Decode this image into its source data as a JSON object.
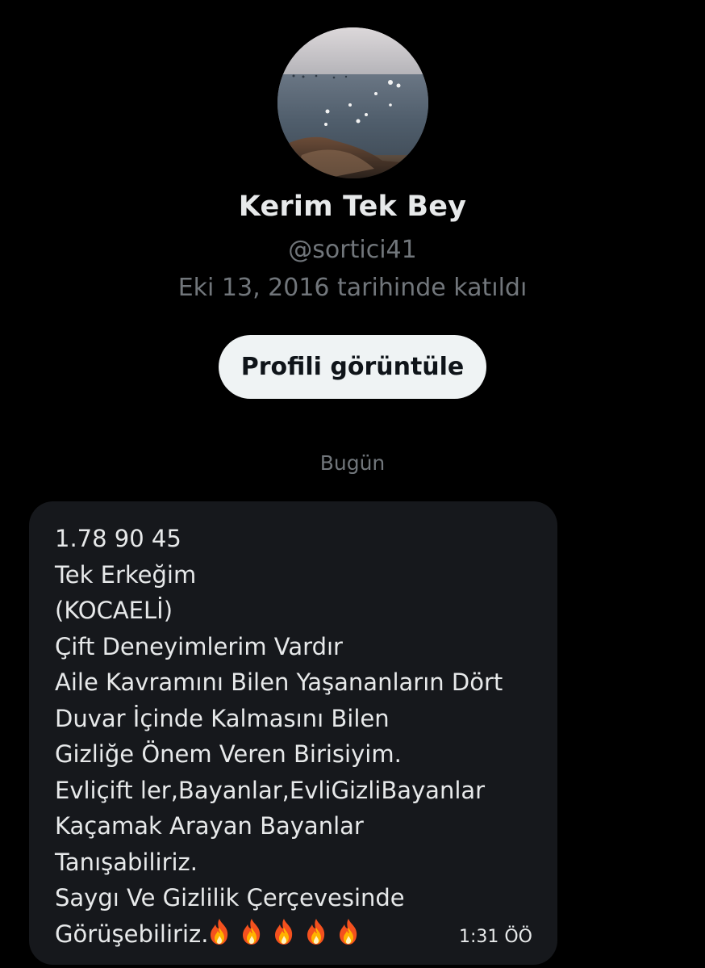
{
  "profile": {
    "display_name": "Kerim Tek Bey",
    "handle": "@sortici41",
    "joined": "Eki 13, 2016 tarihinde katıldı",
    "view_profile_label": "Profili görüntüle"
  },
  "conversation": {
    "day_separator": "Bugün",
    "message": {
      "lines": [
        "1.78 90 45",
        "Tek Erkeğim",
        "(KOCAELİ)",
        "Çift Deneyimlerim Vardır",
        "Aile Kavramını Bilen Yaşananların Dört",
        "Duvar İçinde Kalmasını Bilen",
        "Gizliğe Önem Veren Birisiyim.",
        "Evliçift ler,Bayanlar,EvliGizliBayanlar",
        "Kaçamak Arayan Bayanlar",
        "Tanışabiliriz.",
        "Saygı Ve Gizlilik Çerçevesinde",
        "Görüşebiliriz."
      ],
      "emoji_icon": "fire-icon",
      "emoji_count": 5,
      "timestamp": "1:31 ÖÖ"
    }
  },
  "colors": {
    "background": "#000000",
    "bubble": "#16181c",
    "primary_text": "#e7e9ea",
    "secondary_text": "#71767b",
    "button_bg": "#eff3f4",
    "button_text": "#0f1419"
  }
}
